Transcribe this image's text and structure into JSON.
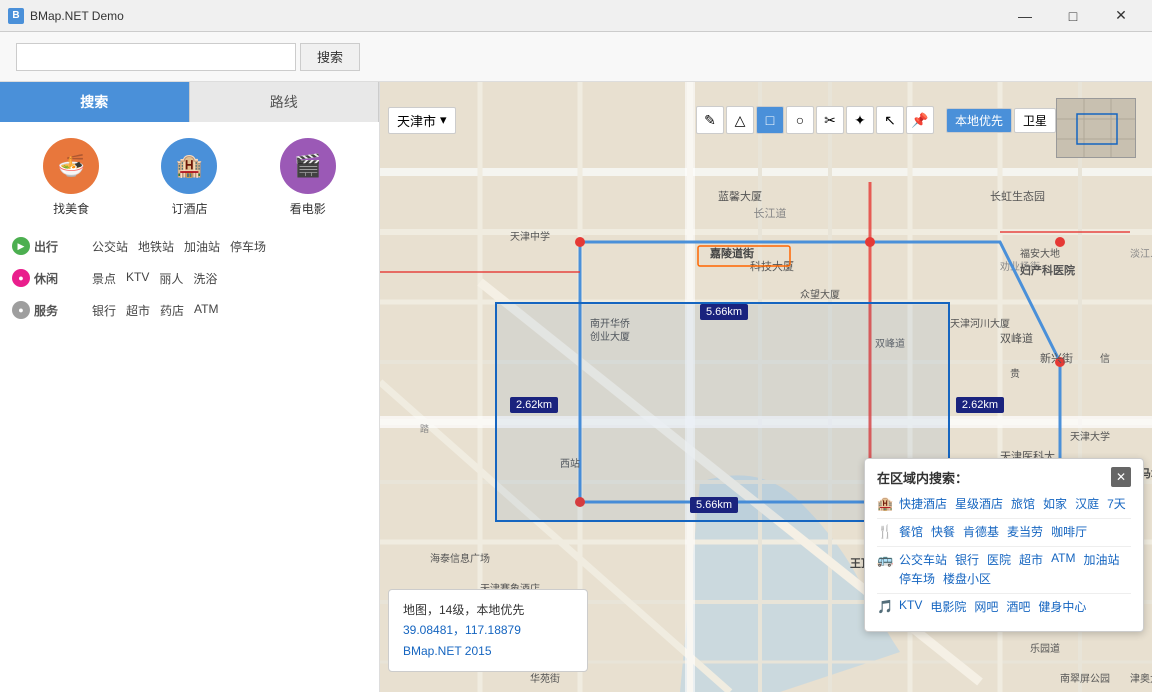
{
  "window": {
    "title": "BMap.NET Demo",
    "min_btn": "—",
    "max_btn": "□",
    "close_btn": "✕"
  },
  "search_bar": {
    "input_placeholder": "",
    "button_label": "搜索"
  },
  "sidebar": {
    "tab_search": "搜索",
    "tab_route": "路线",
    "categories": [
      {
        "id": "food",
        "label": "找美食",
        "icon": "🍜",
        "color_class": "icon-food"
      },
      {
        "id": "hotel",
        "label": "订酒店",
        "icon": "🏨",
        "color_class": "icon-hotel"
      },
      {
        "id": "movie",
        "label": "看电影",
        "icon": "🎬",
        "color_class": "icon-movie"
      }
    ],
    "sub_categories": [
      {
        "id": "going",
        "dot_class": "dot-green",
        "dot_symbol": "▶",
        "name": "出行",
        "items": [
          "公交站",
          "地铁站",
          "加油站",
          "停车场"
        ]
      },
      {
        "id": "leisure",
        "dot_class": "dot-pink",
        "dot_symbol": "●",
        "name": "休闲",
        "items": [
          "景点",
          "KTV",
          "丽人",
          "洗浴"
        ]
      },
      {
        "id": "service",
        "dot_class": "dot-gray",
        "dot_symbol": "●",
        "name": "服务",
        "items": [
          "银行",
          "超市",
          "药店",
          "ATM"
        ]
      }
    ]
  },
  "map": {
    "city_selector": "天津市",
    "city_selector_arrow": "▾",
    "tools": [
      "✎",
      "△",
      "□",
      "○",
      "✂",
      "✦",
      "↖",
      "📌"
    ],
    "local_priority_btn": "本地优先",
    "satellite_btn": "卫星",
    "measure_labels": [
      {
        "text": "5.66km",
        "id": "m1"
      },
      {
        "text": "2.62km",
        "id": "m2"
      },
      {
        "text": "5.66km",
        "id": "m3"
      },
      {
        "text": "2.62km",
        "id": "m4"
      }
    ],
    "info_box": {
      "line1": "地图，14级，本地优先",
      "line2": "39.08481，117.18879",
      "line3": "BMap.NET 2015"
    }
  },
  "area_search_popup": {
    "title": "在区域内搜索：",
    "close_icon": "✕",
    "rows": [
      {
        "icon": "🏨",
        "links": [
          "快捷酒店",
          "星级酒店",
          "旅馆",
          "如家",
          "汉庭",
          "7天"
        ]
      },
      {
        "icon": "🍴",
        "links": [
          "餐馆",
          "快餐",
          "肯德基",
          "麦当劳",
          "咖啡厅"
        ]
      },
      {
        "icon": "🚌",
        "links": [
          "公交车站",
          "银行",
          "医院",
          "超市",
          "ATM",
          "加油站",
          "停车场",
          "楼盘小区"
        ]
      },
      {
        "icon": "🎵",
        "links": [
          "KTV",
          "电影院",
          "网吧",
          "酒吧",
          "健身中心"
        ]
      }
    ]
  }
}
